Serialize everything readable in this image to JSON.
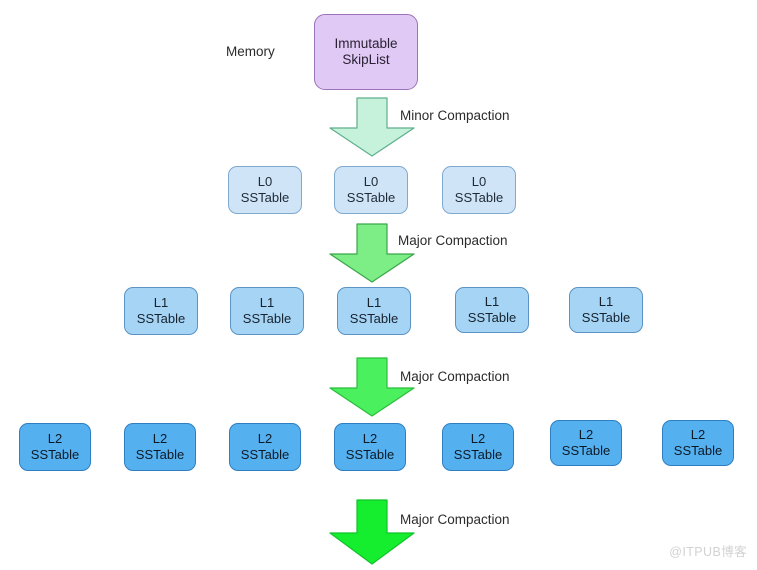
{
  "diagram": {
    "title_label": "Memory",
    "watermark": "@ITPUB博客",
    "memtable": {
      "line1": "Immutable",
      "line2": "SkipList",
      "fill": "#e1c9f5",
      "stroke": "#9c72b8"
    },
    "arrows": [
      {
        "label": "Minor Compaction",
        "fill": "#c6f2dc",
        "stroke": "#5fae8c"
      },
      {
        "label": "Major Compaction",
        "fill": "#7ded86",
        "stroke": "#3aa64a"
      },
      {
        "label": "Major Compaction",
        "fill": "#4bf05e",
        "stroke": "#2bbd3c"
      },
      {
        "label": "Major Compaction",
        "fill": "#15ee2f",
        "stroke": "#0ec428"
      }
    ],
    "levels": [
      {
        "name": "L0",
        "fill": "#cfe4f7",
        "stroke": "#7fa9cf",
        "nodes": [
          {
            "line1": "L0",
            "line2": "SSTable"
          },
          {
            "line1": "L0",
            "line2": "SSTable"
          },
          {
            "line1": "L0",
            "line2": "SSTable"
          }
        ]
      },
      {
        "name": "L1",
        "fill": "#a6d4f5",
        "stroke": "#5a93c4",
        "nodes": [
          {
            "line1": "L1",
            "line2": "SSTable"
          },
          {
            "line1": "L1",
            "line2": "SSTable"
          },
          {
            "line1": "L1",
            "line2": "SSTable"
          },
          {
            "line1": "L1",
            "line2": "SSTable"
          },
          {
            "line1": "L1",
            "line2": "SSTable"
          }
        ]
      },
      {
        "name": "L2",
        "fill": "#55b0f0",
        "stroke": "#2f7fc0",
        "nodes": [
          {
            "line1": "L2",
            "line2": "SSTable"
          },
          {
            "line1": "L2",
            "line2": "SSTable"
          },
          {
            "line1": "L2",
            "line2": "SSTable"
          },
          {
            "line1": "L2",
            "line2": "SSTable"
          },
          {
            "line1": "L2",
            "line2": "SSTable"
          },
          {
            "line1": "L2",
            "line2": "SSTable"
          },
          {
            "line1": "L2",
            "line2": "SSTable"
          }
        ]
      }
    ]
  }
}
